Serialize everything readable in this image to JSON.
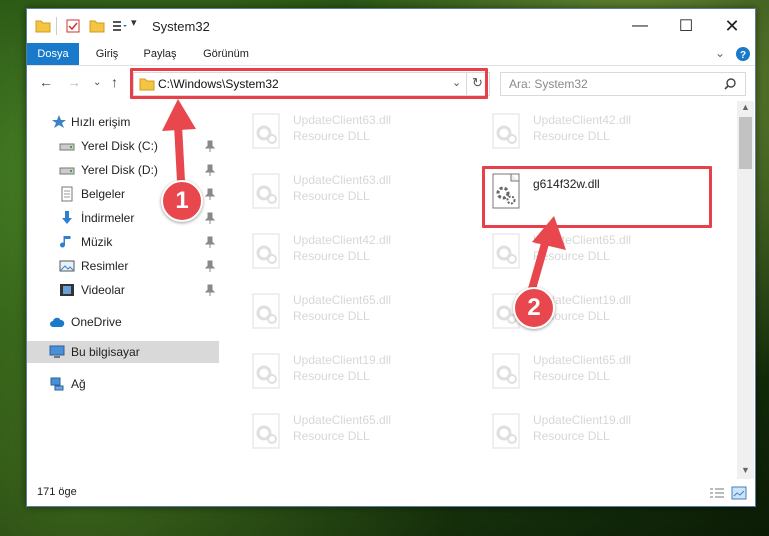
{
  "window": {
    "title": "System32",
    "ribbon_tabs": [
      "Dosya",
      "Giriş",
      "Paylaş",
      "Görünüm"
    ],
    "address": "C:\\Windows\\System32",
    "search_placeholder": "Ara: System32",
    "status": "171 öge"
  },
  "nav": {
    "quick_access": "Hızlı erişim",
    "items": [
      {
        "label": "Yerel Disk (C:)"
      },
      {
        "label": "Yerel Disk (D:)"
      },
      {
        "label": "Belgeler"
      },
      {
        "label": "İndirmeler"
      },
      {
        "label": "Müzik"
      },
      {
        "label": "Resimler"
      },
      {
        "label": "Videolar"
      }
    ],
    "onedrive": "OneDrive",
    "this_pc": "Bu bilgisayar",
    "network": "Ağ"
  },
  "files": {
    "col1": [
      {
        "name": "UpdateClient63.dll",
        "type": "Resource DLL"
      },
      {
        "name": "UpdateClient63.dll",
        "type": "Resource DLL"
      },
      {
        "name": "UpdateClient42.dll",
        "type": "Resource DLL"
      },
      {
        "name": "UpdateClient65.dll",
        "type": "Resource DLL"
      },
      {
        "name": "UpdateClient19.dll",
        "type": "Resource DLL"
      },
      {
        "name": "UpdateClient65.dll",
        "type": "Resource DLL"
      }
    ],
    "col2": [
      {
        "name": "UpdateClient42.dll",
        "type": "Resource DLL"
      },
      {
        "name": "g614f32w.dll",
        "type": ""
      },
      {
        "name": "UpdateClient65.dll",
        "type": "Resource DLL"
      },
      {
        "name": "UpdateClient19.dll",
        "type": "Resource DLL"
      },
      {
        "name": "UpdateClient65.dll",
        "type": "Resource DLL"
      },
      {
        "name": "UpdateClient19.dll",
        "type": "Resource DLL"
      }
    ]
  },
  "annotations": {
    "badge1": "1",
    "badge2": "2"
  },
  "colors": {
    "accent": "#1979ca",
    "highlight": "#e8404a",
    "selected": "#d9d9d9"
  }
}
